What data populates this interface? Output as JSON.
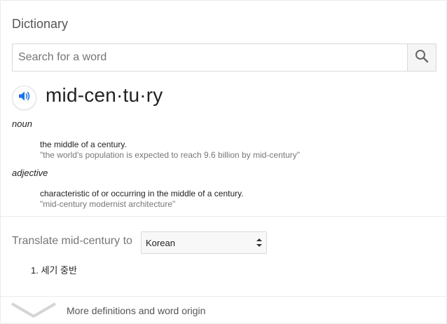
{
  "panel": {
    "title": "Dictionary"
  },
  "search": {
    "placeholder": "Search for a word",
    "value": "",
    "button_icon": "search-icon"
  },
  "entry": {
    "speaker_icon": "speaker-icon",
    "headword": "mid-cen·tu·ry",
    "senses": [
      {
        "part_of_speech": "noun",
        "definition": "the middle of a century.",
        "example": "\"the world's population is expected to reach 9.6 billion by mid-century\""
      },
      {
        "part_of_speech": "adjective",
        "definition": "characteristic of or occurring in the middle of a century.",
        "example": "\"mid-century modernist architecture\""
      }
    ]
  },
  "translate": {
    "label": "Translate mid-century to",
    "selected_language": "Korean",
    "results": [
      "1. 세기 중반"
    ]
  },
  "footer": {
    "more_label": "More definitions and word origin",
    "icon": "chevron-down-icon"
  },
  "colors": {
    "accent": "#1a73e8",
    "muted_text": "#777777",
    "border": "#d9d9d9"
  }
}
